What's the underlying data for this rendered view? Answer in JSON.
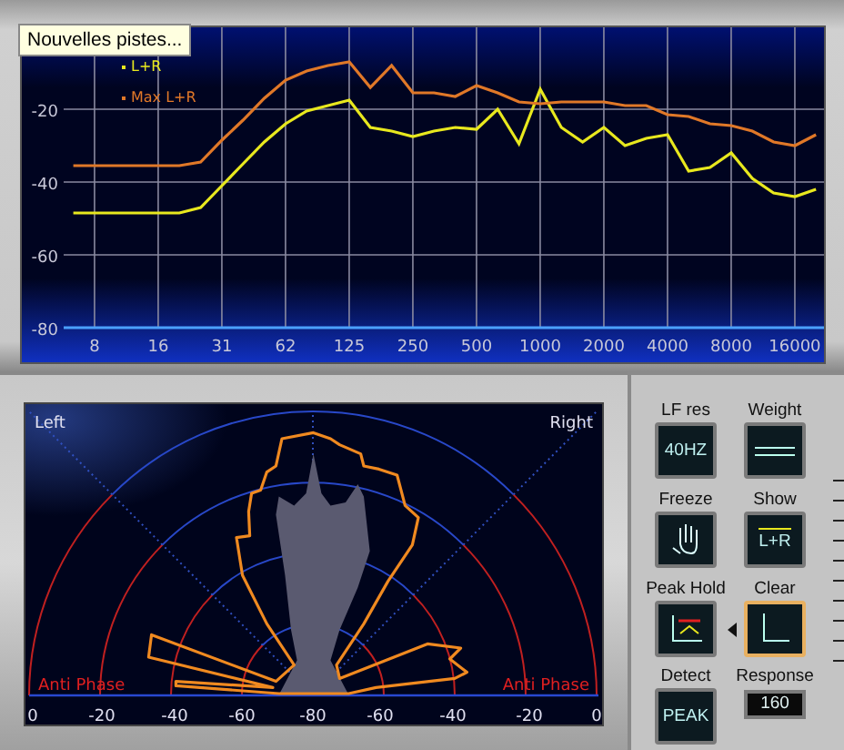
{
  "tooltip": {
    "text": "Nouvelles pistes..."
  },
  "spectrum": {
    "chart_data": {
      "type": "line",
      "categories": [
        null,
        "8",
        null,
        null,
        "16",
        null,
        null,
        "31",
        null,
        null,
        "62",
        null,
        null,
        "125",
        null,
        null,
        "250",
        null,
        null,
        "500",
        null,
        null,
        "1000",
        null,
        null,
        "2000",
        null,
        null,
        "4000",
        null,
        null,
        "8000",
        null,
        null,
        "16000",
        null
      ],
      "series": [
        {
          "name": "L+R",
          "color": "#e8e81e",
          "values": [
            -48.5,
            -48.5,
            -48.5,
            -48.5,
            -48.5,
            -48.5,
            -47,
            -41,
            -35,
            -29,
            -24,
            -20.5,
            -19,
            -17.5,
            -25,
            -26,
            -27.5,
            -26,
            -25,
            -25.5,
            -20,
            -29.5,
            -14.5,
            -25,
            -29,
            -25,
            -30,
            -28,
            -27,
            -37,
            -36,
            -32,
            -39,
            -43,
            -44,
            -42
          ]
        },
        {
          "name": "Max L+R",
          "color": "#e07828",
          "values": [
            -35.5,
            -35.5,
            -35.5,
            -35.5,
            -35.5,
            -35.5,
            -34.5,
            -28.5,
            -23,
            -17,
            -12,
            -9.5,
            -8,
            -7,
            -14,
            -8,
            -15.5,
            -15.5,
            -16.5,
            -13.5,
            -15.5,
            -18,
            -18.5,
            -18,
            -18,
            -18,
            -19,
            -19,
            -21.5,
            -22,
            -24,
            -24.5,
            -26,
            -29,
            -30,
            -27
          ]
        }
      ],
      "grid": true,
      "ylim": [
        -80,
        2.5
      ],
      "yticks": [
        -80,
        -60,
        -40,
        -20
      ]
    }
  },
  "phase": {
    "left_label": "Left",
    "right_label": "Right",
    "anti_phase_left": "Anti Phase",
    "anti_phase_right": "Anti Phase",
    "scale_labels": [
      "0",
      "-20",
      "-40",
      "-60",
      "-80",
      "-60",
      "-40",
      "-20",
      "0"
    ]
  },
  "controls": [
    {
      "label": "LF res",
      "kind": "text",
      "content": "40HZ",
      "selected": false
    },
    {
      "label": "Weight",
      "kind": "lines",
      "selected": false
    },
    {
      "label": "Freeze",
      "kind": "hand",
      "selected": false
    },
    {
      "label": "Show",
      "kind": "text_bar",
      "content": "L+R",
      "selected": false
    },
    {
      "label": "Peak Hold",
      "kind": "peak",
      "selected": false
    },
    {
      "label": "Clear",
      "kind": "axes",
      "selected": true
    },
    {
      "label": "Detect",
      "kind": "text",
      "content": "PEAK",
      "selected": false
    },
    {
      "label": "Response",
      "kind": "value",
      "content": "160",
      "selected": false
    }
  ]
}
